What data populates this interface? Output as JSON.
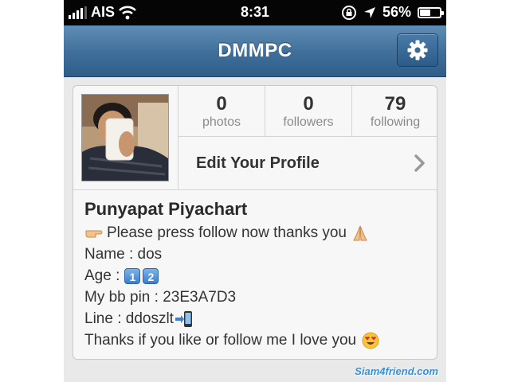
{
  "status_bar": {
    "carrier": "AIS",
    "time": "8:31",
    "battery_percent": "56%",
    "battery_level": 0.56,
    "icons": [
      "signal-bars-icon",
      "wifi-icon",
      "rotation-lock-icon",
      "location-arrow-icon",
      "battery-icon"
    ]
  },
  "nav": {
    "title": "DMMPC",
    "settings_icon": "gear-icon",
    "bar_color": "#3f6e9a"
  },
  "profile": {
    "stats": [
      {
        "value": "0",
        "label": "photos"
      },
      {
        "value": "0",
        "label": "followers"
      },
      {
        "value": "79",
        "label": "following"
      }
    ],
    "edit_label": "Edit Your Profile",
    "name": "Punyapat Piyachart",
    "bio": {
      "line1": "Please press follow now thanks you",
      "line2": "Name : dos",
      "line3_prefix": "Age :",
      "line3_digits": [
        "1",
        "2"
      ],
      "line4": "My bb pin : 23E3A7D3",
      "line5": "Line : ddoszlt",
      "line6": "Thanks if you like or follow me I love you"
    }
  },
  "watermark": "Siam4friend.com"
}
